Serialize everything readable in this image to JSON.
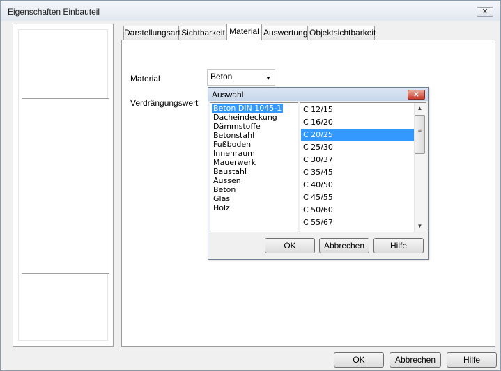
{
  "main_window": {
    "title": "Eigenschaften Einbauteil",
    "close_glyph": "✕",
    "tabs": [
      {
        "label": "Darstellungsart"
      },
      {
        "label": "Sichtbarkeit"
      },
      {
        "label": "Material"
      },
      {
        "label": "Auswertung"
      },
      {
        "label": "Objektsichtbarkeit"
      }
    ],
    "active_tab": "Material",
    "material_label": "Material",
    "material_value": "Beton",
    "verdraengung_label": "Verdrängungswert",
    "buttons": {
      "ok": "OK",
      "cancel": "Abbrechen",
      "help": "Hilfe"
    }
  },
  "dialog": {
    "title": "Auswahl",
    "close_glyph": "✕",
    "left_list": [
      "Beton DIN 1045-1",
      "Dacheindeckung",
      "Dämmstoffe",
      "Betonstahl",
      "Fußboden",
      "Innenraum",
      "Mauerwerk",
      "Baustahl",
      "Aussen",
      "Beton",
      "Glas",
      "Holz"
    ],
    "left_selected": "Beton DIN 1045-1",
    "right_list": [
      "C 12/15",
      "C 16/20",
      "C 20/25",
      "C 25/30",
      "C 30/37",
      "C 35/45",
      "C 40/50",
      "C 45/55",
      "C 50/60",
      "C 55/67"
    ],
    "right_selected": "C 20/25",
    "buttons": {
      "ok": "OK",
      "cancel": "Abbrechen",
      "help": "Hilfe"
    }
  },
  "icons": {
    "dropdown_arrow": "chevron-down-icon",
    "scroll_up": "scroll-up-arrow-icon",
    "scroll_down": "scroll-down-arrow-icon",
    "close": "close-icon"
  },
  "colors": {
    "selection": "#3399ff",
    "dialog_close": "#c8402d",
    "title_bar": "#dbe6f3"
  }
}
